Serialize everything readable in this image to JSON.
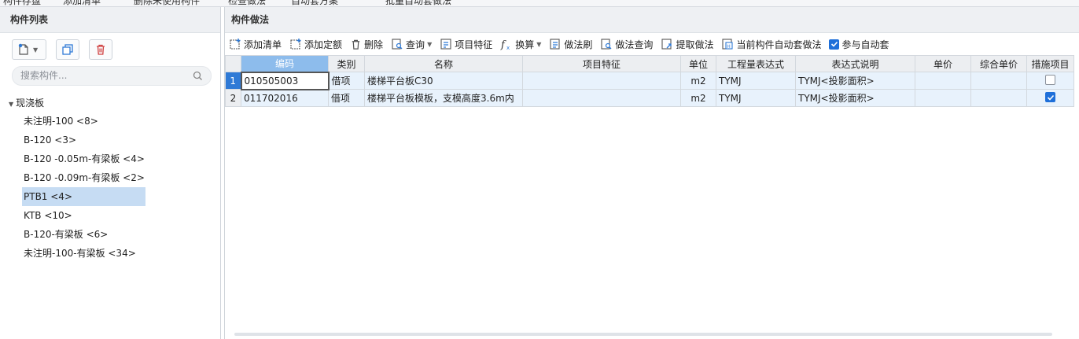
{
  "top_strip": [
    "构件存盘",
    "添加清单",
    "删除未使用构件",
    "检查做法",
    "自动套方案",
    "批量自动套做法"
  ],
  "left_panel": {
    "title": "构件列表",
    "search_placeholder": "搜索构件...",
    "tree": {
      "root": "现浇板",
      "items": [
        {
          "label": "未注明-100 <8>",
          "selected": false
        },
        {
          "label": "B-120 <3>",
          "selected": false
        },
        {
          "label": "B-120  -0.05m-有梁板 <4>",
          "selected": false
        },
        {
          "label": "B-120  -0.09m-有梁板 <2>",
          "selected": false
        },
        {
          "label": "PTB1 <4>",
          "selected": true
        },
        {
          "label": "KTB <10>",
          "selected": false
        },
        {
          "label": "B-120-有梁板 <6>",
          "selected": false
        },
        {
          "label": "未注明-100-有梁板 <34>",
          "selected": false
        }
      ]
    }
  },
  "right_panel": {
    "title": "构件做法",
    "toolbar": {
      "add_list": "添加清单",
      "add_quota": "添加定额",
      "delete": "删除",
      "query": "查询",
      "item_feature": "项目特征",
      "convert": "换算",
      "method_brush": "做法刷",
      "method_query": "做法查询",
      "extract_method": "提取做法",
      "auto_apply_current": "当前构件自动套做法",
      "participate_auto": "参与自动套",
      "participate_auto_checked": true
    },
    "table": {
      "columns": [
        "",
        "编码",
        "类别",
        "名称",
        "项目特征",
        "单位",
        "工程量表达式",
        "表达式说明",
        "单价",
        "综合单价",
        "措施项目"
      ],
      "rows": [
        {
          "no": "1",
          "code": "010505003",
          "type": "借项",
          "name": "楼梯平台板C30",
          "feature": "",
          "unit": "m2",
          "expr": "TYMJ",
          "expr_desc": "TYMJ<投影面积>",
          "price": "",
          "total_price": "",
          "measure": false
        },
        {
          "no": "2",
          "code": "011702016",
          "type": "借项",
          "name": "楼梯平台板模板，支模高度3.6m内",
          "feature": "",
          "unit": "m2",
          "expr": "TYMJ",
          "expr_desc": "TYMJ<投影面积>",
          "price": "",
          "total_price": "",
          "measure": true
        }
      ]
    }
  },
  "colors": {
    "accent": "#2f7ad6",
    "selected_row": "#c6dcf3",
    "header_selected": "#8dbcec"
  }
}
